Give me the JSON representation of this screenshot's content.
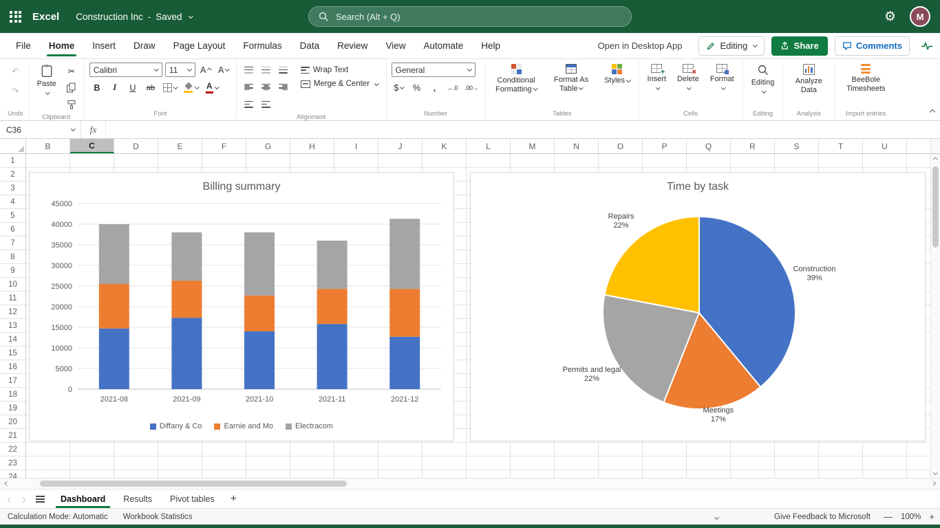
{
  "colors": {
    "topbar_green": "#185C37",
    "accent_green": "#107C41",
    "comments_blue": "#0F6CBD",
    "series_blue": "#4472C4",
    "series_orange": "#ED7D31",
    "series_gray": "#A5A5A5",
    "series_yellow": "#FFC000"
  },
  "topbar": {
    "app_name": "Excel",
    "doc_title": "Construction Inc",
    "separator": "-",
    "doc_status": "Saved",
    "search_placeholder": "Search (Alt + Q)",
    "avatar_initial": "M"
  },
  "menubar": {
    "tabs": [
      {
        "label": "File"
      },
      {
        "label": "Home",
        "active": true
      },
      {
        "label": "Insert"
      },
      {
        "label": "Draw"
      },
      {
        "label": "Page Layout"
      },
      {
        "label": "Formulas"
      },
      {
        "label": "Data"
      },
      {
        "label": "Review"
      },
      {
        "label": "View"
      },
      {
        "label": "Automate"
      },
      {
        "label": "Help"
      }
    ],
    "open_in_desktop": "Open in Desktop App",
    "editing_label": "Editing",
    "share_label": "Share",
    "comments_label": "Comments"
  },
  "ribbon": {
    "undo_label": "Undo",
    "clipboard": {
      "paste_label": "Paste",
      "group_label": "Clipboard"
    },
    "font": {
      "family": "Calibri",
      "size": "11",
      "size_icon_letter": "A",
      "bold": "B",
      "italic": "I",
      "underline": "U",
      "strikethrough": "ab",
      "group_label": "Font"
    },
    "alignment": {
      "wrap_text": "Wrap Text",
      "merge_center": "Merge & Center",
      "group_label": "Alignment"
    },
    "number": {
      "format": "General",
      "currency": "$",
      "percent": "%",
      "comma": ",",
      "increase_decimal_icon": "←.0",
      "decrease_decimal_icon": ".00→",
      "group_label": "Number"
    },
    "tables": {
      "conditional_formatting": "Conditional Formatting",
      "format_as_table": "Format As Table",
      "styles": "Styles",
      "group_label": "Tables"
    },
    "cells": {
      "insert": "Insert",
      "delete": "Delete",
      "format": "Format",
      "group_label": "Cells"
    },
    "editing": {
      "label": "Editing",
      "group_label": "Editing"
    },
    "analysis": {
      "analyze_data": "Analyze Data",
      "group_label": "Analysis"
    },
    "import": {
      "beebole": "BeeBole Timesheets",
      "group_label": "Import entries"
    }
  },
  "formula_bar": {
    "name_box": "C36",
    "fx": "fx",
    "formula": ""
  },
  "grid": {
    "columns": [
      "B",
      "C",
      "D",
      "E",
      "F",
      "G",
      "H",
      "I",
      "J",
      "K",
      "L",
      "M",
      "N",
      "O",
      "P",
      "Q",
      "R",
      "S",
      "T",
      "U"
    ],
    "selected_column": "C",
    "rows": [
      1,
      2,
      3,
      4,
      5,
      6,
      7,
      8,
      9,
      10,
      11,
      12,
      13,
      14,
      15,
      16,
      17,
      18,
      19,
      20,
      21,
      22,
      23,
      24
    ]
  },
  "chart_data": [
    {
      "type": "bar",
      "stacked": true,
      "title": "Billing summary",
      "categories": [
        "2021-08",
        "2021-09",
        "2021-10",
        "2021-11",
        "2021-12"
      ],
      "series": [
        {
          "name": "Diffany & Co",
          "color": "#4472C4",
          "values": [
            14700,
            17300,
            14000,
            15800,
            12700
          ]
        },
        {
          "name": "Earnie and Mo",
          "color": "#ED7D31",
          "values": [
            10800,
            9000,
            8700,
            8500,
            11600
          ]
        },
        {
          "name": "Electracom",
          "color": "#A5A5A5",
          "values": [
            14500,
            11700,
            15300,
            11700,
            17000
          ]
        }
      ],
      "xlabel": "",
      "ylabel": "",
      "ylim": [
        0,
        45000
      ],
      "ytick_step": 5000,
      "grid": true,
      "legend_position": "bottom"
    },
    {
      "type": "pie",
      "title": "Time by task",
      "slices": [
        {
          "label": "Construction",
          "pct": 39,
          "color": "#4472C4"
        },
        {
          "label": "Meetings",
          "pct": 17,
          "color": "#ED7D31"
        },
        {
          "label": "Permits and legal",
          "pct": 22,
          "color": "#A5A5A5"
        },
        {
          "label": "Repairs",
          "pct": 22,
          "color": "#FFC000"
        }
      ],
      "start_angle_deg": 0,
      "direction": "clockwise",
      "labels_outside": true
    }
  ],
  "sheet_tabs": {
    "tabs": [
      {
        "label": "Dashboard",
        "active": true
      },
      {
        "label": "Results"
      },
      {
        "label": "Pivot tables"
      }
    ],
    "add_label": "+"
  },
  "status_bar": {
    "calculation_mode": "Calculation Mode: Automatic",
    "workbook_statistics": "Workbook Statistics",
    "feedback": "Give Feedback to Microsoft",
    "zoom_out": "—",
    "zoom": "100%",
    "zoom_in": "+"
  }
}
